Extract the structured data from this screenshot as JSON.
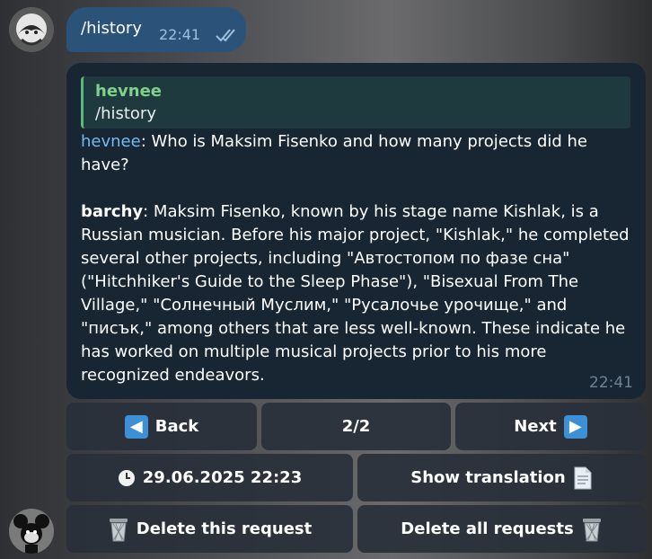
{
  "outgoing": {
    "text": "/history",
    "time": "22:41",
    "status_icon": "double-check-icon"
  },
  "incoming": {
    "quote_author": "hevnee",
    "quote_text": "/history",
    "user_name": "hevnee",
    "question": ": Who is Maksim Fisenko and how many projects did he have?",
    "bot_name": "barchy",
    "answer": ": Maksim Fisenko, known by his stage name Kishlak, is a Russian musician. Before his major project, \"Kishlak,\" he completed several other projects, including \"Автостопом по фазе сна\" (\"Hitchhiker's Guide to the Sleep Phase\"), \"Bisexual From The Village,\" \"Солнечный Муслим,\" \"Русалочье урочище,\" and \"писък,\" among others that are less well-known. These indicate he has worked on multiple musical projects prior to his more recognized endeavors.",
    "time": "22:41"
  },
  "keyboard": {
    "back": "Back",
    "page": "2/2",
    "next": "Next",
    "date": "29.06.2025 22:23",
    "show_translation": "Show translation",
    "delete_this": "Delete this request",
    "delete_all": "Delete all requests"
  },
  "colors": {
    "outgoing_bubble": "#2b5278",
    "incoming_bubble": "#182533",
    "user_name": "#71baf2",
    "quote_author": "#7fd18b",
    "button_bg": "#2b3542",
    "arrow_emoji": "#3d8fd6"
  }
}
